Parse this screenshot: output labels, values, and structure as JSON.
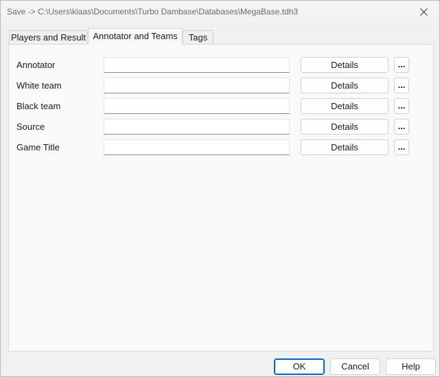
{
  "window": {
    "title": "Save -> C:\\Users\\klaas\\Documents\\Turbo Dambase\\Databases\\MegaBase.tdh3"
  },
  "tabs": [
    {
      "label": "Players and Result",
      "active": false
    },
    {
      "label": "Annotator and Teams",
      "active": true
    },
    {
      "label": "Tags",
      "active": false
    }
  ],
  "fields": [
    {
      "label": "Annotator",
      "value": "",
      "details_label": "Details",
      "more_label": "..."
    },
    {
      "label": "White team",
      "value": "",
      "details_label": "Details",
      "more_label": "..."
    },
    {
      "label": "Black team",
      "value": "",
      "details_label": "Details",
      "more_label": "..."
    },
    {
      "label": "Source",
      "value": "",
      "details_label": "Details",
      "more_label": "..."
    },
    {
      "label": "Game Title",
      "value": "",
      "details_label": "Details",
      "more_label": "..."
    }
  ],
  "footer": {
    "ok_label": "OK",
    "cancel_label": "Cancel",
    "help_label": "Help"
  },
  "colors": {
    "default_button_accent": "#0067c0",
    "panel_background": "#f9f9f9",
    "window_background": "#f0f0f0"
  },
  "icons": {
    "close": "close-icon"
  }
}
